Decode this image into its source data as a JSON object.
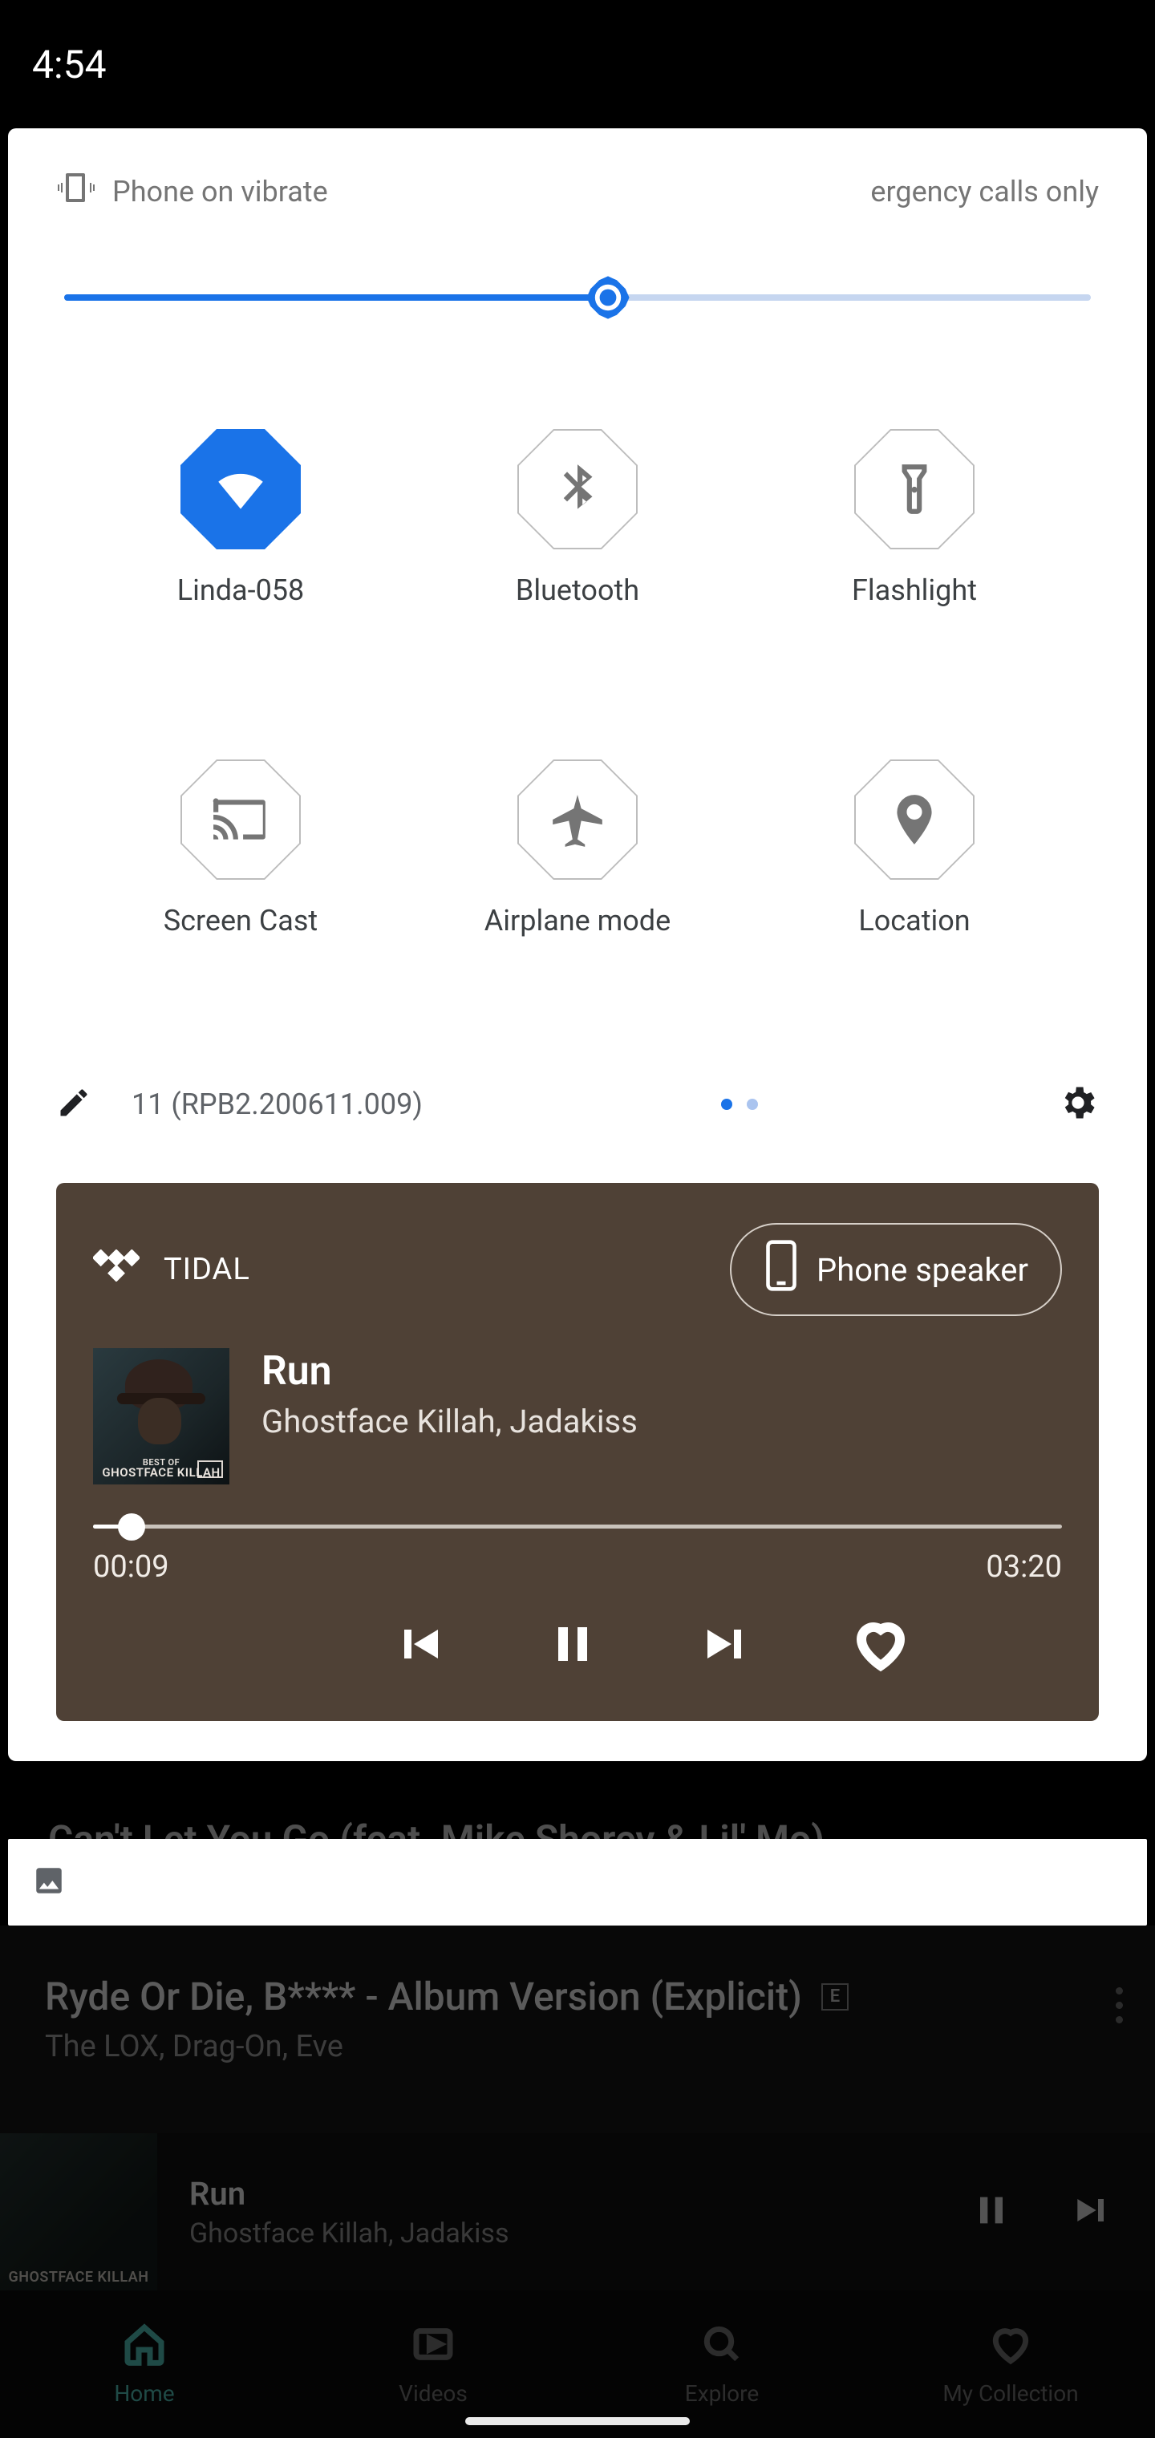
{
  "statusbar": {
    "time": "4:54"
  },
  "panel": {
    "status_left": "Phone on vibrate",
    "status_right": "ergency calls only",
    "brightness_pct": 53,
    "tiles": [
      {
        "label": "Linda-058",
        "icon": "wifi-icon",
        "active": true
      },
      {
        "label": "Bluetooth",
        "icon": "bluetooth-icon",
        "active": false
      },
      {
        "label": "Flashlight",
        "icon": "flashlight-icon",
        "active": false
      },
      {
        "label": "Screen Cast",
        "icon": "cast-icon",
        "active": false
      },
      {
        "label": "Airplane mode",
        "icon": "airplane-icon",
        "active": false
      },
      {
        "label": "Location",
        "icon": "location-icon",
        "active": false
      }
    ],
    "build": "11 (RPB2.200611.009)",
    "page_dots": {
      "count": 2,
      "active": 0
    }
  },
  "media": {
    "app": "TIDAL",
    "output": "Phone speaker",
    "track": {
      "title": "Run",
      "artist": "Ghostface Killah, Jadakiss"
    },
    "album_art_caption": "GHOSTFACE KILLAH",
    "album_art_top": "BEST OF",
    "elapsed": "00:09",
    "duration": "03:20",
    "progress_pct": 4
  },
  "peek_behind": "Can't Let You Go (feat. Mike Shorey & Lil' Mo)",
  "bg": {
    "list_title": "Ryde Or Die, B**** - Album Version (Explicit)",
    "explicit_badge": "E",
    "list_artist": "The LOX, Drag-On, Eve",
    "mini": {
      "title": "Run",
      "artist": "Ghostface Killah, Jadakiss",
      "art_caption": "GHOSTFACE KILLAH"
    },
    "tabs": [
      {
        "label": "Home",
        "icon": "home-icon",
        "active": true
      },
      {
        "label": "Videos",
        "icon": "video-icon",
        "active": false
      },
      {
        "label": "Explore",
        "icon": "search-icon",
        "active": false
      },
      {
        "label": "My Collection",
        "icon": "heart-icon",
        "active": false
      }
    ]
  }
}
